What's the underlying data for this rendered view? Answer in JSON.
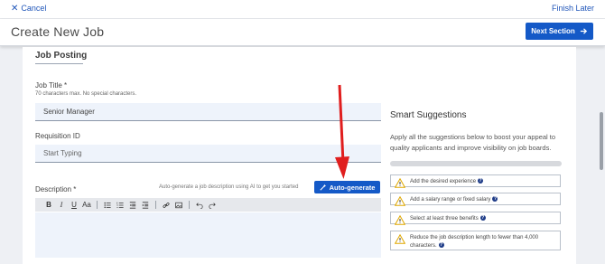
{
  "topbar": {
    "cancel_label": "Cancel",
    "finish_later_label": "Finish Later"
  },
  "header": {
    "title": "Create New Job",
    "next_button_label": "Next Section"
  },
  "job_posting": {
    "section_title": "Job Posting",
    "job_title": {
      "label": "Job Title *",
      "hint": "70 characters max. No special characters.",
      "value": "Senior Manager"
    },
    "requisition_id": {
      "label": "Requisition ID",
      "placeholder": "Start Typing"
    },
    "description": {
      "label": "Description *",
      "autogen_hint": "Auto-generate a job description using AI to get you started",
      "autogen_button_label": "Auto-generate",
      "toolbar": {
        "bold": "B",
        "italic": "I",
        "underline": "U",
        "font_size": "Aa"
      }
    }
  },
  "smart_suggestions": {
    "title": "Smart Suggestions",
    "description": "Apply all the suggestions below to boost your appeal to quality applicants and improve visibility on job boards.",
    "progress": 0.0,
    "items": [
      {
        "text": "Add the desired experience"
      },
      {
        "text": "Add a salary range or fixed salary"
      },
      {
        "text": "Select at least three benefits"
      },
      {
        "text": "Reduce the job description length to fewer than 4,000 characters."
      }
    ]
  },
  "colors": {
    "primary": "#1459c7",
    "warning": "#e0a800",
    "annotation_arrow": "#e01e1e"
  }
}
